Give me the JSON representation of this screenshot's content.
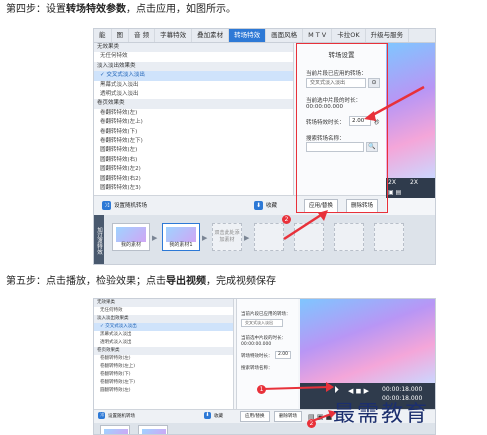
{
  "step4": {
    "prefix": "第四步：设置",
    "bold": "转场特效参数",
    "suffix": "，点击应用，如图所示。"
  },
  "step5": {
    "prefix": "第五步：点击播放，检验效果；点击",
    "bold": "导出视频",
    "suffix": "，完成视频保存"
  },
  "app": {
    "tabs": [
      "能",
      "图",
      "音 频",
      "字幕特效",
      "叠加素材",
      "转场特效",
      "画面风格",
      "M T V",
      "卡拉OK",
      "升级与服务"
    ],
    "active_tab_index": 5,
    "list_items": [
      {
        "text": "无效果类",
        "kind": "group"
      },
      {
        "text": "无任何特效",
        "kind": "item"
      },
      {
        "text": "淡入淡出效果类",
        "kind": "group"
      },
      {
        "text": "✓ 交叉式淡入淡出",
        "kind": "selected"
      },
      {
        "text": "黑幕式淡入淡出",
        "kind": "item"
      },
      {
        "text": "透明式淡入淡出",
        "kind": "item"
      },
      {
        "text": "卷页效果类",
        "kind": "group"
      },
      {
        "text": "卷翻转特效(左)",
        "kind": "item"
      },
      {
        "text": "卷翻转特效(左上)",
        "kind": "item"
      },
      {
        "text": "卷翻转特效(下)",
        "kind": "item"
      },
      {
        "text": "卷翻转特效(左下)",
        "kind": "item"
      },
      {
        "text": "圆翻转特效(左)",
        "kind": "item"
      },
      {
        "text": "圆翻转特效(右)",
        "kind": "item"
      },
      {
        "text": "圆翻转特效(左2)",
        "kind": "item"
      },
      {
        "text": "圆翻转特效(右2)",
        "kind": "item"
      },
      {
        "text": "圆翻转特效(左3)",
        "kind": "item"
      }
    ],
    "settings": {
      "title": "转场设置",
      "current_label": "当前片段已应用的转场：",
      "current_value": "交叉式淡入淡出",
      "duration_label": "当前选中片段的时长：",
      "duration_value": "00:00:00.000",
      "transition_duration_label": "转场特效时长：",
      "transition_duration_value": "2.00",
      "transition_unit": "秒",
      "search_label": "搜索转场名称：",
      "search_placeholder": "",
      "search_icon_label": "🔍"
    },
    "bar": {
      "random_label": "设置随机转场",
      "favorite_label": "收藏",
      "apply_label": "应用/替换",
      "delete_label": "删除转场"
    },
    "preview": {
      "zoom1": "2X",
      "zoom2": "2X",
      "time1": "00:00:18.000",
      "time2": "00:00:18.000"
    },
    "timeline": {
      "side_label": "加过渡特效",
      "clip1": "我的素材",
      "clip2": "我的素材1",
      "placeholder": "双击此处添加素材"
    }
  },
  "watermark": "最需教育",
  "badges": {
    "one": "1",
    "two": "2"
  },
  "colors": {
    "accent": "#2d79d6",
    "annotation": "#e8313a"
  }
}
